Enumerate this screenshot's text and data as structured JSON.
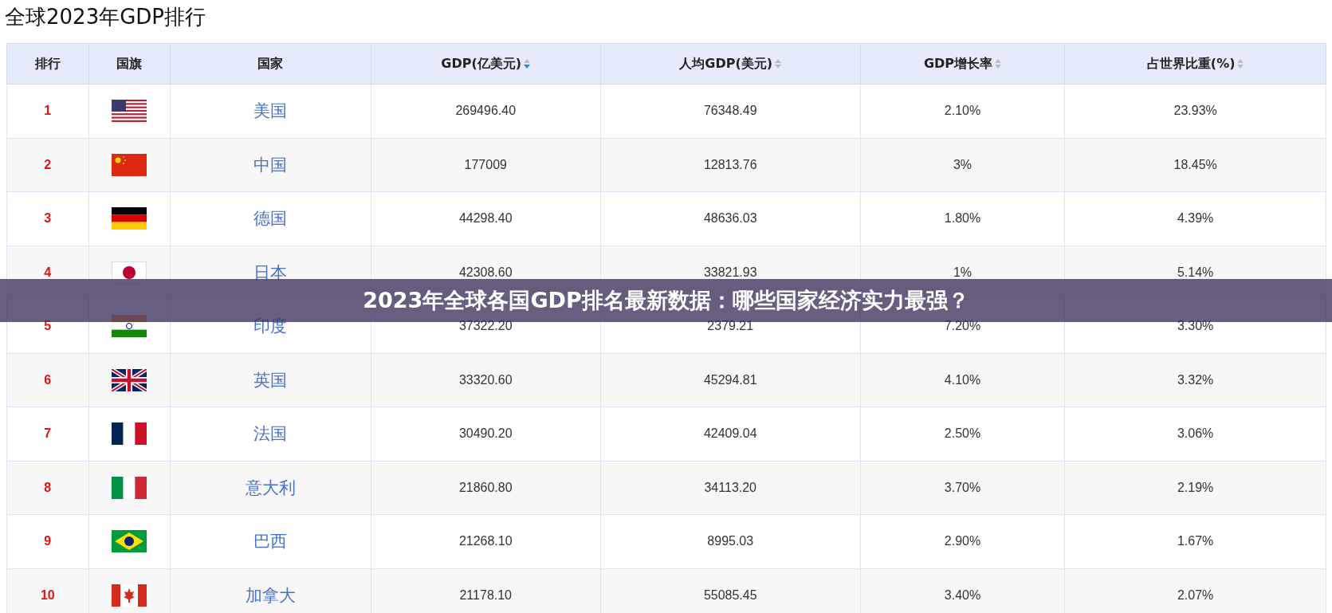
{
  "title": "全球2023年GDP排行",
  "columns": [
    {
      "label": "排行",
      "sortable": false
    },
    {
      "label": "国旗",
      "sortable": false
    },
    {
      "label": "国家",
      "sortable": false
    },
    {
      "label": "GDP(亿美元)",
      "sortable": true,
      "sorted": true
    },
    {
      "label": "人均GDP(美元)",
      "sortable": true,
      "sorted": false
    },
    {
      "label": "GDP增长率",
      "sortable": true,
      "sorted": false
    },
    {
      "label": "占世界比重(%)",
      "sortable": true,
      "sorted": false
    }
  ],
  "rows": [
    {
      "rank": "1",
      "kind": "us",
      "country": "美国",
      "gdp": "269496.40",
      "per_capita": "76348.49",
      "growth": "2.10%",
      "share": "23.93%"
    },
    {
      "rank": "2",
      "kind": "cn",
      "country": "中国",
      "gdp": "177009",
      "per_capita": "12813.76",
      "growth": "3%",
      "share": "18.45%"
    },
    {
      "rank": "3",
      "kind": "de",
      "country": "德国",
      "gdp": "44298.40",
      "per_capita": "48636.03",
      "growth": "1.80%",
      "share": "4.39%"
    },
    {
      "rank": "4",
      "kind": "jp",
      "country": "日本",
      "gdp": "42308.60",
      "per_capita": "33821.93",
      "growth": "1%",
      "share": "5.14%"
    },
    {
      "rank": "5",
      "kind": "in",
      "country": "印度",
      "gdp": "37322.20",
      "per_capita": "2379.21",
      "growth": "7.20%",
      "share": "3.30%"
    },
    {
      "rank": "6",
      "kind": "gb",
      "country": "英国",
      "gdp": "33320.60",
      "per_capita": "45294.81",
      "growth": "4.10%",
      "share": "3.32%"
    },
    {
      "rank": "7",
      "kind": "fr",
      "country": "法国",
      "gdp": "30490.20",
      "per_capita": "42409.04",
      "growth": "2.50%",
      "share": "3.06%"
    },
    {
      "rank": "8",
      "kind": "it",
      "country": "意大利",
      "gdp": "21860.80",
      "per_capita": "34113.20",
      "growth": "3.70%",
      "share": "2.19%"
    },
    {
      "rank": "9",
      "kind": "br",
      "country": "巴西",
      "gdp": "21268.10",
      "per_capita": "8995.03",
      "growth": "2.90%",
      "share": "1.67%"
    },
    {
      "rank": "10",
      "kind": "ca",
      "country": "加拿大",
      "gdp": "21178.10",
      "per_capita": "55085.45",
      "growth": "3.40%",
      "share": "2.07%"
    }
  ],
  "banner": "2023年全球各国GDP排名最新数据：哪些国家经济实力最强？"
}
